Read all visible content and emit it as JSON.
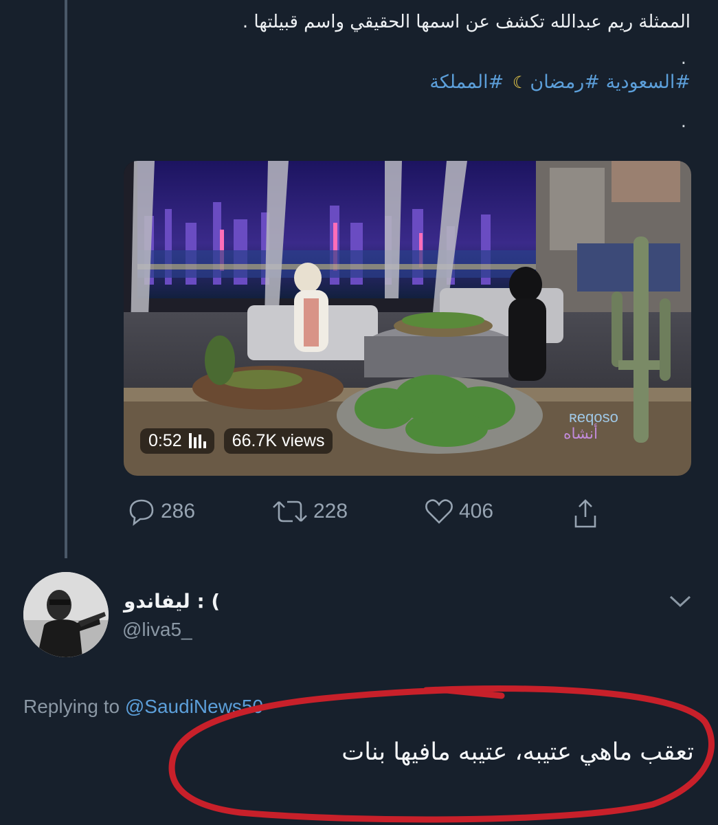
{
  "tweet": {
    "text": "الممثلة ريم عبدالله تكشف عن اسمها الحقيقي واسم قبيلتها .",
    "dot1": ".",
    "hashtags": [
      "#السعودية",
      "#رمضان",
      "#المملكة"
    ],
    "dot2": ".",
    "video": {
      "duration": "0:52",
      "views": "66.7K views"
    },
    "actions": {
      "replies": "286",
      "retweets": "228",
      "likes": "406"
    }
  },
  "reply": {
    "display_name": "ليفاندو : (",
    "handle": "@liva5_",
    "replying_prefix": "Replying to",
    "replying_to": "@SaudiNews50",
    "text": "تعقب ماهي عتيبه، عتيبه مافيها بنات"
  },
  "colors": {
    "background": "#17202c",
    "link": "#5c9fda",
    "muted": "#8b98a5",
    "annotation": "#c8202a"
  },
  "icons": [
    "reply-icon",
    "retweet-icon",
    "like-icon",
    "share-icon",
    "chevron-down-icon",
    "moon-emoji-icon",
    "audio-bars-icon"
  ]
}
